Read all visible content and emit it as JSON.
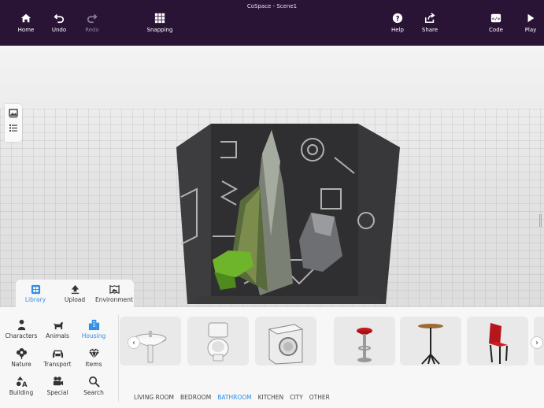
{
  "window_title": "CoSpace - Scene1",
  "toolbar": {
    "home": "Home",
    "undo": "Undo",
    "redo": "Redo",
    "snapping": "Snapping",
    "help": "Help",
    "share": "Share",
    "code": "Code",
    "play": "Play"
  },
  "tabs": [
    {
      "label": "Library",
      "icon": "library-icon",
      "active": true
    },
    {
      "label": "Upload",
      "icon": "upload-icon",
      "active": false
    },
    {
      "label": "Environment",
      "icon": "environment-icon",
      "active": false
    }
  ],
  "categories": [
    {
      "label": "Characters",
      "icon": "person-icon"
    },
    {
      "label": "Animals",
      "icon": "dog-icon"
    },
    {
      "label": "Housing",
      "icon": "buildings-icon",
      "active": true
    },
    {
      "label": "Nature",
      "icon": "flower-icon"
    },
    {
      "label": "Transport",
      "icon": "car-icon"
    },
    {
      "label": "Items",
      "icon": "gem-icon"
    },
    {
      "label": "Building",
      "icon": "shapes-icon"
    },
    {
      "label": "Special",
      "icon": "camera-icon"
    },
    {
      "label": "Search",
      "icon": "search-icon"
    }
  ],
  "subcategories": [
    "LIVING ROOM",
    "BEDROOM",
    "BATHROOM",
    "KITCHEN",
    "CITY",
    "OTHER"
  ],
  "active_subcategory": "BATHROOM",
  "items": [
    "sink",
    "toilet",
    "washing-machine",
    "bar-stool",
    "bar-table",
    "red-chair"
  ],
  "colors": {
    "toolbar_bg": "#2a1436",
    "accent": "#2f8de4"
  }
}
